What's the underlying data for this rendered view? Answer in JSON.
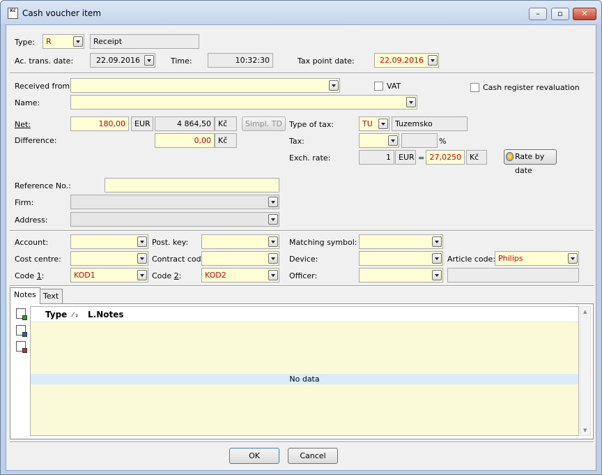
{
  "window": {
    "title": "Cash voucher item",
    "icon_text": "Kč"
  },
  "header": {
    "type_label": "Type:",
    "type_value": "R",
    "type_desc": "Receipt",
    "ac_date_label": "Ac. trans. date:",
    "ac_date_value": "22.09.2016",
    "time_label": "Time:",
    "time_value": "10:32:30",
    "tax_point_label": "Tax point date:",
    "tax_point_value": "22.09.2016"
  },
  "parties": {
    "received_label": "Received from:",
    "received_value": "",
    "vat_label": "VAT",
    "vat_checked": false,
    "revaluation_label": "Cash register revaluation",
    "revaluation_checked": false,
    "name_label": "Name:",
    "name_value": ""
  },
  "amounts": {
    "net_label": "Net:",
    "net_value": "180,00",
    "net_currency": "EUR",
    "net_local": "4 864,50",
    "local_currency": "Kč",
    "simpl_td_label": "Simpl. TD",
    "diff_label": "Difference:",
    "diff_value": "0,00",
    "diff_currency": "Kč",
    "type_of_tax_label": "Type of tax:",
    "type_of_tax_code": "TU",
    "type_of_tax_desc": "Tuzemsko",
    "tax_label": "Tax:",
    "tax_value": "",
    "tax_percent": "",
    "percent_sign": "%",
    "exch_label": "Exch. rate:",
    "exch_amount": "1",
    "exch_currency": "EUR",
    "equals": "=",
    "exch_value": "27,0250",
    "exch_local": "Kč",
    "rate_by_date_label": "Rate by date"
  },
  "refs": {
    "reference_label": "Reference No.:",
    "reference_value": "",
    "firm_label": "Firm:",
    "firm_value": "",
    "address_label": "Address:",
    "address_value": ""
  },
  "coding": {
    "account_label": "Account:",
    "account_value": "",
    "post_key_label": "Post. key:",
    "post_key_value": "",
    "matching_label": "Matching symbol:",
    "matching_value": "",
    "cost_centre_label": "Cost centre:",
    "cost_centre_value": "",
    "contract_label": "Contract code:",
    "contract_value": "",
    "device_label": "Device:",
    "device_value": "",
    "article_label": "Article code:",
    "article_value": "Philips",
    "code1_label_a": "Code ",
    "code1_label_b": "1",
    "code1_label_c": ":",
    "code1_value": "KOD1",
    "code2_label_a": "Code ",
    "code2_label_b": "2",
    "code2_label_c": ":",
    "code2_value": "KOD2",
    "officer_label": "Officer:",
    "officer_value": "",
    "officer_desc": ""
  },
  "tabs": {
    "notes": "Notes",
    "text": "Text"
  },
  "notes_grid": {
    "col_type": "Type",
    "sort_marker": "⁄ ₂",
    "col_notes": "L.Notes",
    "empty_text": "No data"
  },
  "footer": {
    "ok_label": "OK",
    "cancel_label": "Cancel"
  }
}
